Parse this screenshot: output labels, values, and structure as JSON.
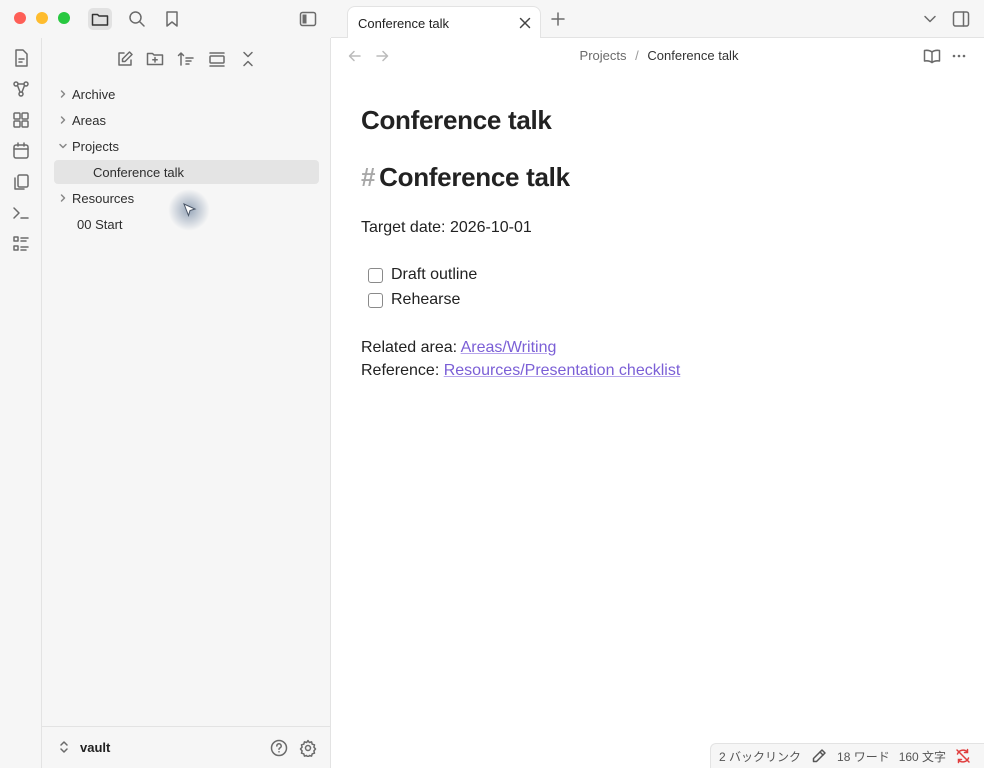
{
  "window": {
    "traffic_lights": {
      "close": "#fe5f57",
      "minimize": "#febc2e",
      "maximize": "#28c840"
    }
  },
  "sidebar": {
    "tree": [
      {
        "label": "Archive",
        "expanded": false
      },
      {
        "label": "Areas",
        "expanded": false
      },
      {
        "label": "Projects",
        "expanded": true
      },
      {
        "label": "Conference talk",
        "selected": true
      },
      {
        "label": "Resources",
        "expanded": false
      },
      {
        "label": "00 Start"
      }
    ],
    "vault_name": "vault"
  },
  "tabs": [
    {
      "label": "Conference talk",
      "active": true
    }
  ],
  "breadcrumb": {
    "parent": "Projects",
    "separator": "/",
    "current": "Conference talk"
  },
  "note": {
    "inline_title": "Conference talk",
    "heading_hash": "#",
    "heading": "Conference talk",
    "target_date": "Target date: 2026-10-01",
    "tasks": [
      {
        "label": "Draft outline",
        "checked": false
      },
      {
        "label": "Rehearse",
        "checked": false
      }
    ],
    "related_prefix": "Related area: ",
    "related_link": "Areas/Writing",
    "reference_prefix": "Reference: ",
    "reference_link": "Resources/Presentation checklist"
  },
  "status": {
    "backlinks": "2 バックリンク",
    "words": "18 ワード",
    "chars": "160 文字"
  },
  "colors": {
    "accent_link": "#7b5fd6",
    "sync_error": "#e03e3e"
  }
}
